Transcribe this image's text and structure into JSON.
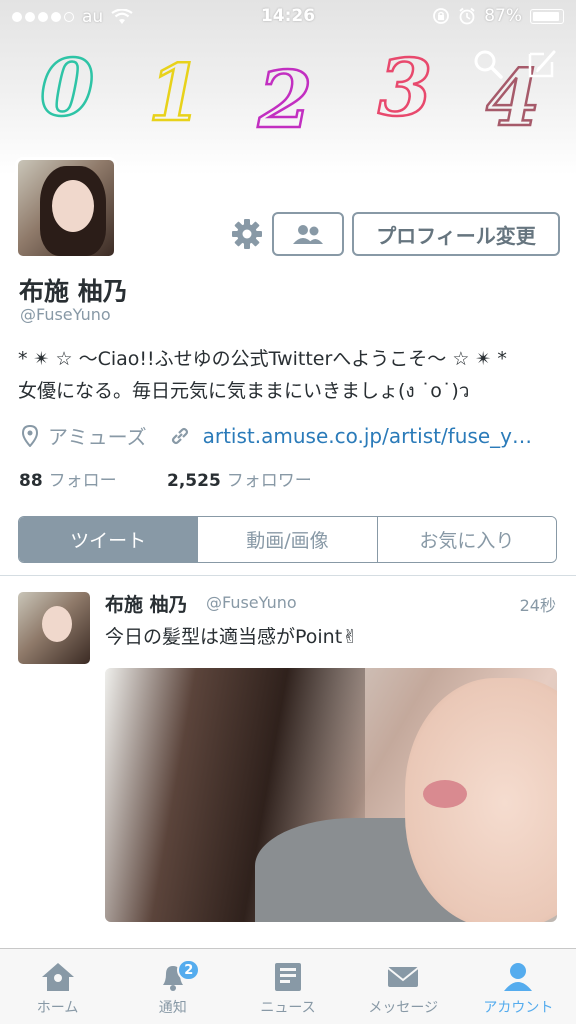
{
  "status_bar": {
    "carrier": "au",
    "time": "14:26",
    "battery": "87%"
  },
  "header": {
    "digits": [
      "0",
      "1",
      "2",
      "3",
      "4"
    ],
    "digit_colors": [
      "#2ec4a6",
      "#e8d21a",
      "#c22fc1",
      "#e8496d",
      "#a65a6a"
    ]
  },
  "profile": {
    "name": "布施 柚乃",
    "handle": "@FuseYuno",
    "edit_button": "プロフィール変更",
    "bio_line1": "* ✴ ☆ 〜Ciao!!ふせゆの公式Twitterへようこそ〜 ☆ ✴ *",
    "bio_line2": "女優になる。毎日元気に気ままにいきましょ(ง ˙o˙)ว",
    "location": "アミューズ",
    "url": "artist.amuse.co.jp/artist/fuse_yuno/",
    "following_count": "88",
    "following_label": "フォロー",
    "followers_count": "2,525",
    "followers_label": "フォロワー"
  },
  "tabs": [
    {
      "label": "ツイート",
      "active": true
    },
    {
      "label": "動画/画像",
      "active": false
    },
    {
      "label": "お気に入り",
      "active": false
    }
  ],
  "tweet": {
    "name": "布施 柚乃",
    "handle": "@FuseYuno",
    "time": "24秒",
    "text": "今日の髪型は適当感がPoint✌"
  },
  "tab_bar": {
    "home": "ホーム",
    "notifications": "通知",
    "notifications_badge": "2",
    "news": "ニュース",
    "messages": "メッセージ",
    "account": "アカウント"
  },
  "colors": {
    "accent": "#55acee",
    "link": "#2b7bb9",
    "muted": "#8899a6",
    "text": "#292f33"
  }
}
